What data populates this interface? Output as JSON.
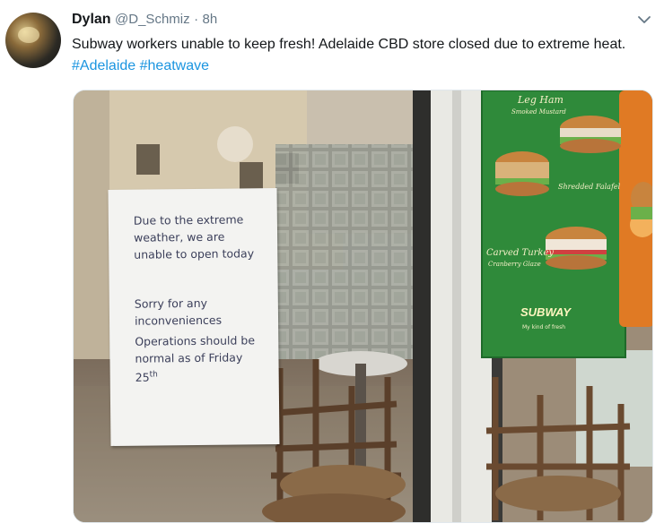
{
  "tweet": {
    "display_name": "Dylan",
    "handle": "@D_Schmiz",
    "separator": "·",
    "timestamp": "8h",
    "text": "Subway workers unable to keep fresh! Adelaide CBD store closed due to extreme heat.",
    "hashtags": [
      "#Adelaide",
      "#heatwave"
    ],
    "menu_icon": "chevron-down-icon"
  },
  "photo": {
    "notice": {
      "line1": "Due to the extreme\nweather, we are\nunable to open today",
      "line2": "Sorry for any\ninconveniences",
      "line3": "Operations should be\nnormal as of Friday\n25",
      "line3_sup": "th"
    },
    "ad": {
      "item1": "Leg Ham",
      "item1_sub": "Smoked Mustard",
      "item2": "Shredded Falafel",
      "item3": "Carved Turkey",
      "item3_sub": "Cranberry Glaze",
      "logo": "SUBWAY",
      "tagline": "My kind of fresh"
    }
  }
}
